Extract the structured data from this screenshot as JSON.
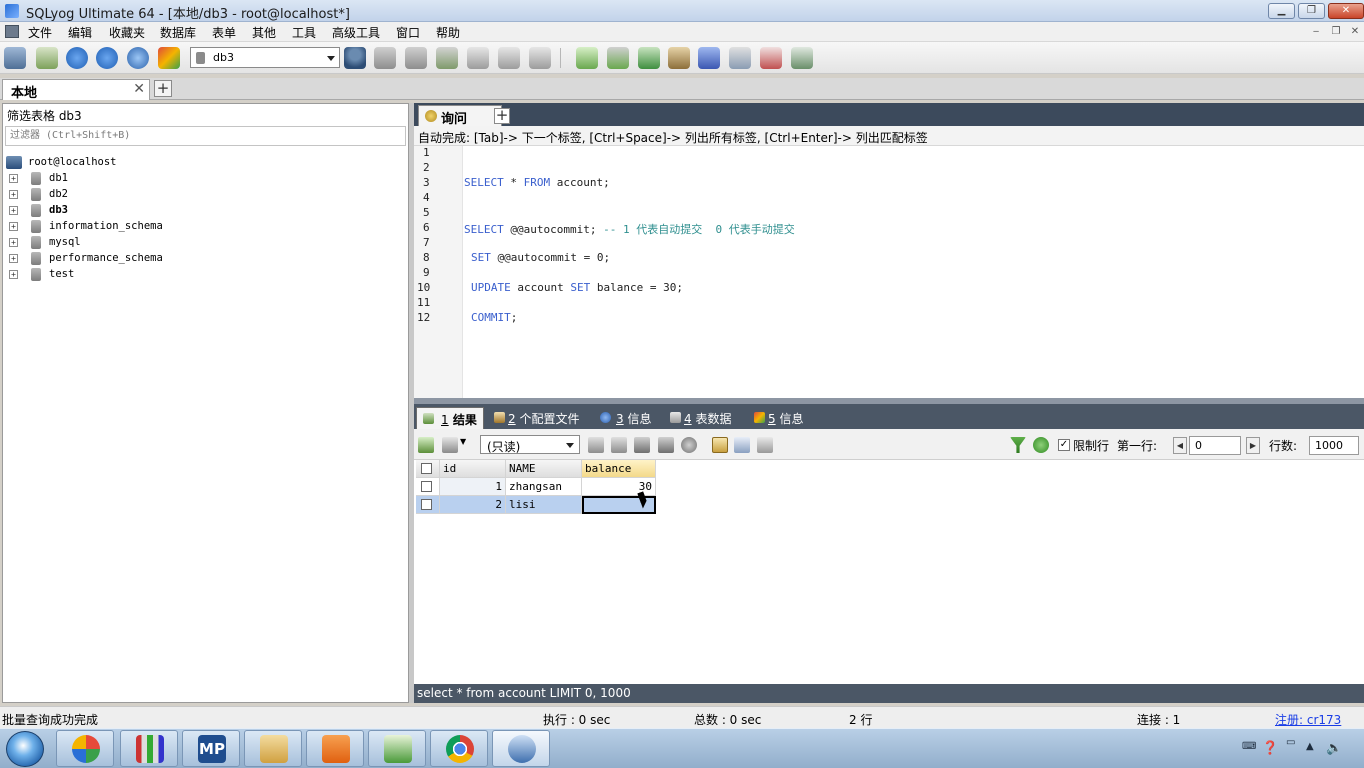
{
  "window": {
    "title": "SQLyog Ultimate 64 - [本地/db3 - root@localhost*]",
    "controls": [
      "▁",
      "❐",
      "✕"
    ]
  },
  "menu": {
    "items": [
      "文件",
      "编辑",
      "收藏夹",
      "数据库",
      "表单",
      "其他",
      "工具",
      "高级工具",
      "窗口",
      "帮助"
    ],
    "mdi_controls": [
      "‒",
      "❐",
      "✕"
    ]
  },
  "toolbar": {
    "database_select": "db3",
    "icons": [
      "new-connection-icon",
      "sql-icon",
      "execute-icon",
      "execute-all-icon",
      "refresh-icon",
      "stop-icon",
      "user-icon",
      "create-db-icon",
      "create-table-icon",
      "alter-table-icon",
      "table-data-icon",
      "index-icon",
      "export-icon",
      "import-icon",
      "sync-icon",
      "compare-icon",
      "schema-icon",
      "backup-icon",
      "query-builder-icon",
      "schema-designer-icon"
    ]
  },
  "connection_tab": {
    "label": "本地",
    "close": "✕",
    "add": "+"
  },
  "object_browser": {
    "filter_label": "筛选表格 db3",
    "filter_placeholder": "过滤器 (Ctrl+Shift+B)",
    "server": "root@localhost",
    "databases": [
      {
        "name": "db1",
        "bold": false
      },
      {
        "name": "db2",
        "bold": false
      },
      {
        "name": "db3",
        "bold": true
      },
      {
        "name": "information_schema",
        "bold": false
      },
      {
        "name": "mysql",
        "bold": false
      },
      {
        "name": "performance_schema",
        "bold": false
      },
      {
        "name": "test",
        "bold": false
      }
    ]
  },
  "query": {
    "tab_label": "询问",
    "autocomplete_hint": "自动完成: [Tab]-> 下一个标签, [Ctrl+Space]-> 列出所有标签, [Ctrl+Enter]-> 列出匹配标签",
    "line_numbers": [
      "1",
      "2",
      "3",
      "4",
      "5",
      "6",
      "7",
      "8",
      "9",
      "10",
      "11",
      "12"
    ],
    "lines": {
      "l3_kw1": "SELECT",
      "l3_rest1": " * ",
      "l3_kw2": "FROM",
      "l3_rest2": " account;",
      "l6_kw": "SELECT",
      "l6_rest": " @@autocommit; ",
      "l6_comment": "-- 1 代表自动提交  0 代表手动提交",
      "l8_kw": "SET",
      "l8_rest": " @@autocommit = 0;",
      "l10_kw1": "UPDATE",
      "l10_rest1": " account ",
      "l10_kw2": "SET",
      "l10_rest2": " balance = 30;",
      "l12_kw": "COMMIT",
      "l12_rest": ";"
    }
  },
  "result_tabs": [
    {
      "num": "1",
      "label": " 结果"
    },
    {
      "num": "2",
      "label": " 个配置文件"
    },
    {
      "num": "3",
      "label": " 信息"
    },
    {
      "num": "4",
      "label": " 表数据"
    },
    {
      "num": "5",
      "label": " 信息"
    }
  ],
  "result_toolbar": {
    "mode": "(只读)",
    "limit_checked": "✓",
    "limit_label": "限制行",
    "first_row_label": "第一行:",
    "first_row_value": "0",
    "rows_label": "行数:",
    "rows_value": "1000"
  },
  "grid": {
    "columns": [
      "id",
      "NAME",
      "balance"
    ],
    "rows": [
      {
        "id": "1",
        "name": "zhangsan",
        "balance": "30"
      },
      {
        "id": "2",
        "name": "lisi",
        "balance": ""
      }
    ]
  },
  "sql_status": "select * from account LIMIT 0, 1000",
  "statusbar": {
    "message": "批量查询成功完成",
    "exec": "执行 : 0 sec",
    "total": "总数 : 0 sec",
    "rows": "2 行",
    "connections": "连接 : 1",
    "register": "注册:  cr173"
  },
  "taskbar": {
    "apps": [
      "start-orb",
      "color-app",
      "notepad-app",
      "mp-app",
      "explorer-app",
      "pdf-app",
      "editor-app",
      "chrome-app",
      "sqlyog-app"
    ],
    "mp_label": "MP"
  },
  "colors": {
    "keyword": "#3a5fcd",
    "comment": "#2f8f8f",
    "selection": "#b9d0ef",
    "panel_dark": "#4b5766"
  }
}
